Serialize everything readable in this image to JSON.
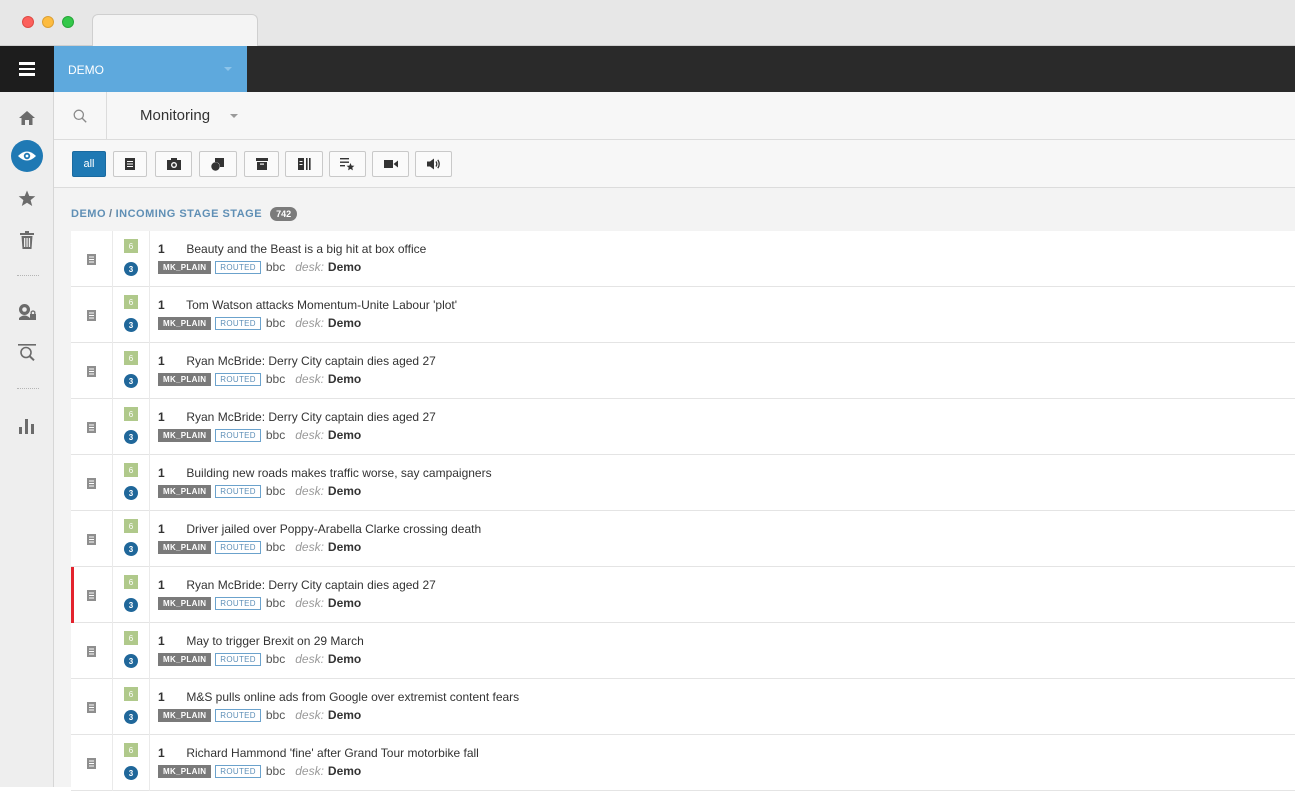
{
  "topbar": {
    "desk_name": "DEMO"
  },
  "searchbar": {
    "view_name": "Monitoring"
  },
  "filters": [
    {
      "label": "all",
      "icon": "all",
      "active": true
    },
    {
      "label": "",
      "icon": "text-icon"
    },
    {
      "label": "",
      "icon": "camera-icon"
    },
    {
      "label": "",
      "icon": "graphic-icon"
    },
    {
      "label": "",
      "icon": "composite-icon"
    },
    {
      "label": "",
      "icon": "highlight-icon"
    },
    {
      "label": "",
      "icon": "starred-list-icon"
    },
    {
      "label": "",
      "icon": "video-icon"
    },
    {
      "label": "",
      "icon": "audio-icon"
    }
  ],
  "group": {
    "desk": "DEMO",
    "sep": "/",
    "stage": "INCOMING STAGE STAGE",
    "count": "742"
  },
  "items": [
    {
      "version": "1",
      "urgency": "6",
      "priority": "3",
      "headline": "Beauty and the Beast is a big hit at box office",
      "tag": "MK_PLAIN",
      "state": "ROUTED",
      "source": "bbc",
      "desk_label": "desk:",
      "desk": "Demo"
    },
    {
      "version": "1",
      "urgency": "6",
      "priority": "3",
      "headline": "Tom Watson attacks Momentum-Unite Labour 'plot'",
      "tag": "MK_PLAIN",
      "state": "ROUTED",
      "source": "bbc",
      "desk_label": "desk:",
      "desk": "Demo"
    },
    {
      "version": "1",
      "urgency": "6",
      "priority": "3",
      "headline": "Ryan McBride: Derry City captain dies aged 27",
      "tag": "MK_PLAIN",
      "state": "ROUTED",
      "source": "bbc",
      "desk_label": "desk:",
      "desk": "Demo"
    },
    {
      "version": "1",
      "urgency": "6",
      "priority": "3",
      "headline": "Ryan McBride: Derry City captain dies aged 27",
      "tag": "MK_PLAIN",
      "state": "ROUTED",
      "source": "bbc",
      "desk_label": "desk:",
      "desk": "Demo"
    },
    {
      "version": "1",
      "urgency": "6",
      "priority": "3",
      "headline": "Building new roads makes traffic worse, say campaigners",
      "tag": "MK_PLAIN",
      "state": "ROUTED",
      "source": "bbc",
      "desk_label": "desk:",
      "desk": "Demo"
    },
    {
      "version": "1",
      "urgency": "6",
      "priority": "3",
      "headline": "Driver jailed over Poppy-Arabella Clarke crossing death",
      "tag": "MK_PLAIN",
      "state": "ROUTED",
      "source": "bbc",
      "desk_label": "desk:",
      "desk": "Demo"
    },
    {
      "version": "1",
      "urgency": "6",
      "priority": "3",
      "headline": "Ryan McBride: Derry City captain dies aged 27",
      "tag": "MK_PLAIN",
      "state": "ROUTED",
      "source": "bbc",
      "desk_label": "desk:",
      "desk": "Demo",
      "selected": true
    },
    {
      "version": "1",
      "urgency": "6",
      "priority": "3",
      "headline": "May to trigger Brexit on 29 March",
      "tag": "MK_PLAIN",
      "state": "ROUTED",
      "source": "bbc",
      "desk_label": "desk:",
      "desk": "Demo"
    },
    {
      "version": "1",
      "urgency": "6",
      "priority": "3",
      "headline": "M&S pulls online ads from Google over extremist content fears",
      "tag": "MK_PLAIN",
      "state": "ROUTED",
      "source": "bbc",
      "desk_label": "desk:",
      "desk": "Demo"
    },
    {
      "version": "1",
      "urgency": "6",
      "priority": "3",
      "headline": "Richard Hammond 'fine' after Grand Tour motorbike fall",
      "tag": "MK_PLAIN",
      "state": "ROUTED",
      "source": "bbc",
      "desk_label": "desk:",
      "desk": "Demo"
    }
  ],
  "colors": {
    "accent": "#1f79b4",
    "desk_bar": "#5ea9dd",
    "selected_marker": "#e3232d",
    "topbar": "#2a2a2a"
  }
}
